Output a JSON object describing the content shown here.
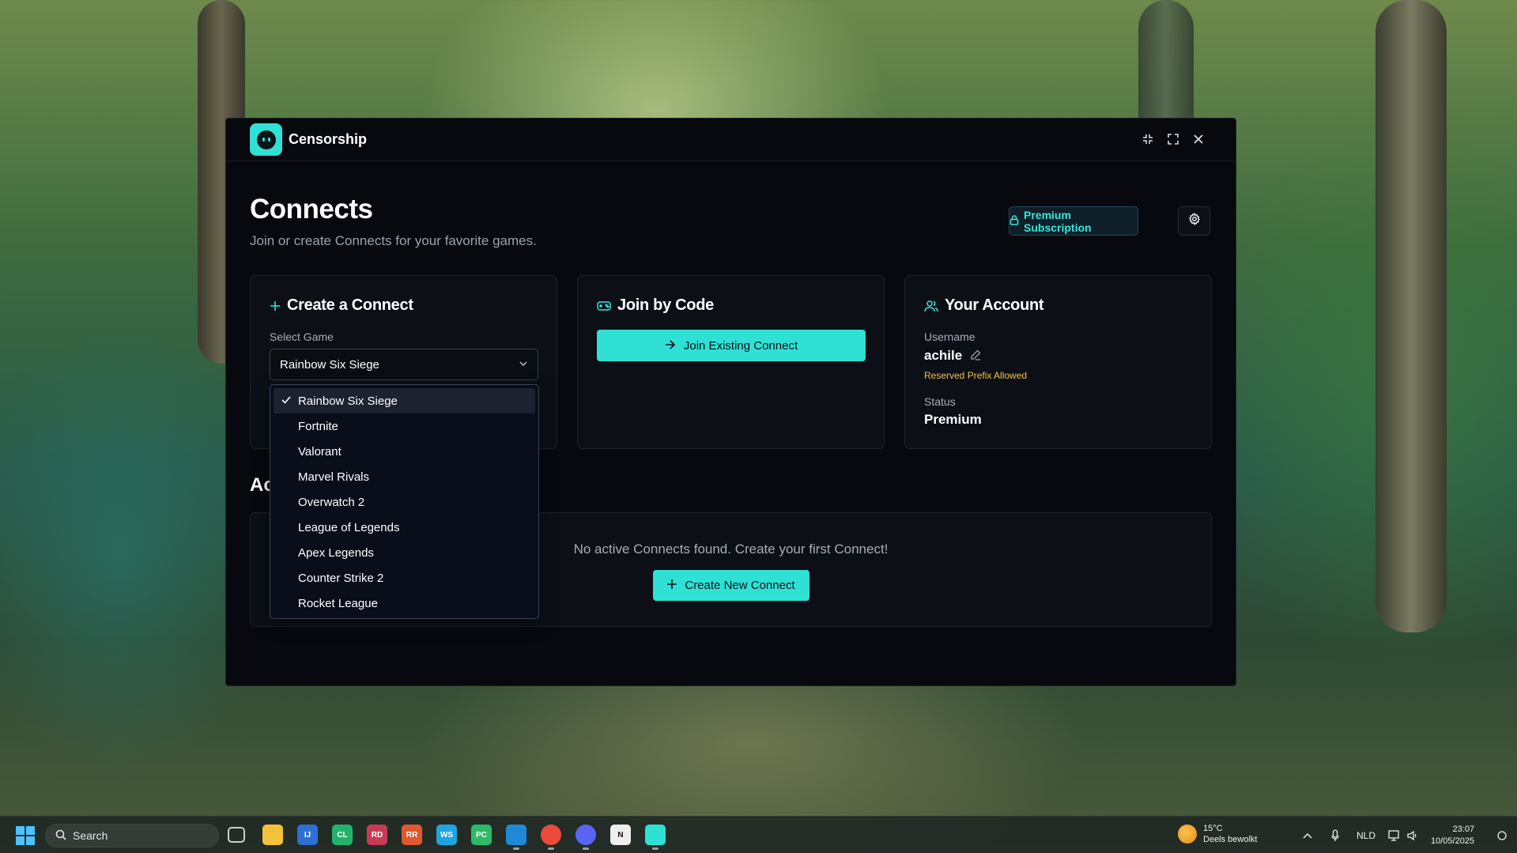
{
  "window": {
    "app_title": "Censorship",
    "controls": [
      "minimize-icon",
      "maximize-icon",
      "close-icon"
    ]
  },
  "page": {
    "title": "Connects",
    "subtitle": "Join or create Connects for your favorite games.",
    "premium_button": "Premium Subscription"
  },
  "create_card": {
    "title": "Create a Connect",
    "select_label": "Select Game",
    "selected_game": "Rainbow Six Siege",
    "options": [
      "Rainbow Six Siege",
      "Fortnite",
      "Valorant",
      "Marvel Rivals",
      "Overwatch 2",
      "League of Legends",
      "Apex Legends",
      "Counter Strike 2",
      "Rocket League"
    ]
  },
  "join_card": {
    "title": "Join by Code",
    "button": "Join Existing Connect"
  },
  "account_card": {
    "title": "Your Account",
    "username_label": "Username",
    "username": "achile",
    "prefix_note": "Reserved Prefix Allowed",
    "status_label": "Status",
    "status": "Premium"
  },
  "active": {
    "title": "Ac",
    "empty_message": "No active Connects found. Create your first Connect!",
    "create_button": "Create New Connect"
  },
  "taskbar": {
    "search_placeholder": "Search",
    "weather_temp": "15°C",
    "weather_desc": "Deels bewolkt",
    "language": "NLD",
    "time": "23:07",
    "date": "10/05/2025",
    "apps": [
      {
        "name": "task-view",
        "label": "",
        "color": "#5f6b73"
      },
      {
        "name": "file-explorer",
        "label": "",
        "color": "#f3c13a"
      },
      {
        "name": "intellij",
        "label": "IJ",
        "color": "#2f6fd4"
      },
      {
        "name": "clion",
        "label": "CL",
        "color": "#21b36a"
      },
      {
        "name": "rider",
        "label": "RD",
        "color": "#c73c55"
      },
      {
        "name": "rustrover",
        "label": "RR",
        "color": "#e0582f"
      },
      {
        "name": "webstorm",
        "label": "WS",
        "color": "#1fa4e0"
      },
      {
        "name": "pycharm",
        "label": "PC",
        "color": "#2dbb6a"
      },
      {
        "name": "vscode",
        "label": "",
        "color": "#1e8ad6"
      },
      {
        "name": "chrome",
        "label": "",
        "color": "#e94a3a"
      },
      {
        "name": "discord",
        "label": "",
        "color": "#5865f2"
      },
      {
        "name": "notion",
        "label": "N",
        "color": "#eeeeee"
      },
      {
        "name": "censorship",
        "label": "",
        "color": "#2fe0d5"
      }
    ]
  },
  "colors": {
    "accent": "#2fe0d5",
    "warning": "#f2c14b",
    "window_bg": "#07090e",
    "card_bg": "#0c1016"
  }
}
